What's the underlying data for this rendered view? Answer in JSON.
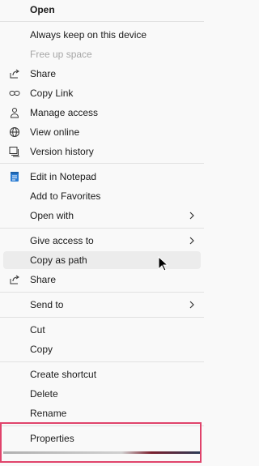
{
  "menu": {
    "open": "Open",
    "always_keep": "Always keep on this device",
    "free_up_space": "Free up space",
    "share_onedrive": "Share",
    "copy_link": "Copy Link",
    "manage_access": "Manage access",
    "view_online": "View online",
    "version_history": "Version history",
    "edit_notepad": "Edit in Notepad",
    "add_favorites": "Add to Favorites",
    "open_with": "Open with",
    "give_access": "Give access to",
    "copy_as_path": "Copy as path",
    "share": "Share",
    "send_to": "Send to",
    "cut": "Cut",
    "copy": "Copy",
    "create_shortcut": "Create shortcut",
    "delete": "Delete",
    "rename": "Rename",
    "properties": "Properties"
  },
  "icons": {
    "share_onedrive": "share-icon",
    "copy_link": "link-icon",
    "manage_access": "person-icon",
    "view_online": "globe-icon",
    "version_history": "version-history-icon",
    "edit_notepad": "notepad-icon",
    "share": "share-icon",
    "submenu": "chevron-right-icon"
  },
  "colors": {
    "highlight_border": "#e0436b",
    "hover_bg": "#ececec",
    "disabled_text": "#a6a6a6"
  }
}
